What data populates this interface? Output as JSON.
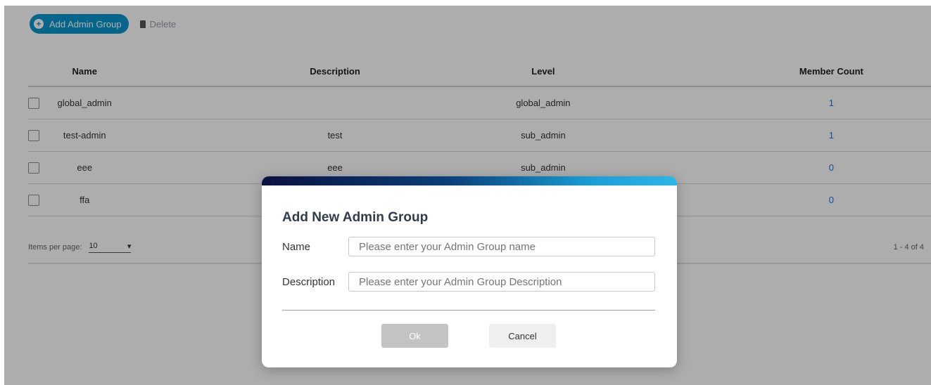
{
  "toolbar": {
    "add_label": "Add Admin Group",
    "delete_label": "Delete"
  },
  "table": {
    "headers": {
      "name": "Name",
      "description": "Description",
      "level": "Level",
      "member_count": "Member Count"
    },
    "rows": [
      {
        "name": "global_admin",
        "description": "",
        "level": "global_admin",
        "member_count": "1"
      },
      {
        "name": "test-admin",
        "description": "test",
        "level": "sub_admin",
        "member_count": "1"
      },
      {
        "name": "eee",
        "description": "eee",
        "level": "sub_admin",
        "member_count": "0"
      },
      {
        "name": "ffa",
        "description": "",
        "level": "",
        "member_count": "0"
      }
    ]
  },
  "paginator": {
    "items_per_page_label": "Items per page:",
    "items_per_page_value": "10",
    "range_label": "1 - 4 of 4"
  },
  "modal": {
    "title": "Add New Admin Group",
    "name_label": "Name",
    "name_placeholder": "Please enter your Admin Group name",
    "description_label": "Description",
    "description_placeholder": "Please enter your Admin Group Description",
    "ok_label": "Ok",
    "cancel_label": "Cancel"
  },
  "colors": {
    "accent": "#0a96cc",
    "link": "#1a73e8",
    "header_gradient_start": "#0b1140",
    "header_gradient_end": "#2bb7e6"
  }
}
